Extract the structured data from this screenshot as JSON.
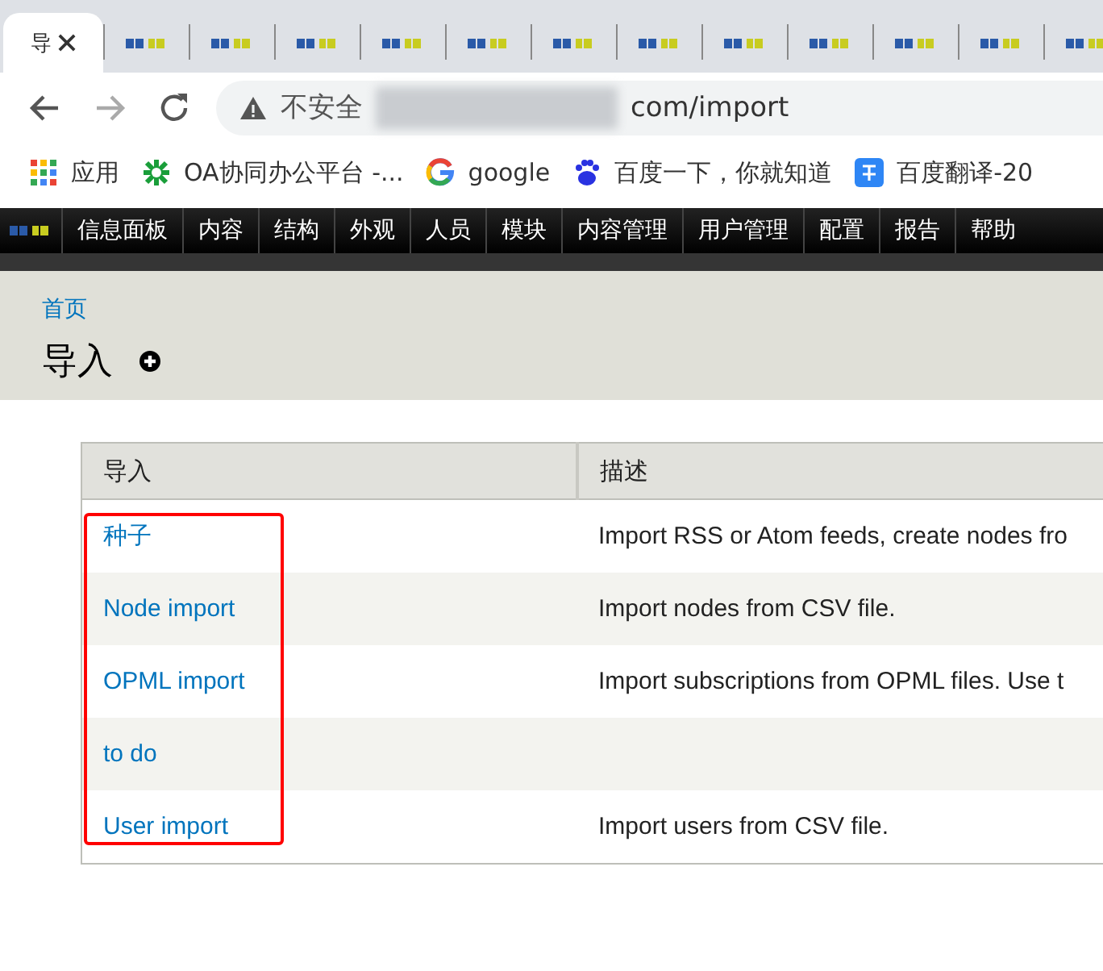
{
  "browser": {
    "tabs": [
      {
        "title": "导",
        "selected": true,
        "closable": true
      },
      {
        "selected": false
      },
      {
        "selected": false
      },
      {
        "selected": false
      },
      {
        "selected": false
      },
      {
        "selected": false
      },
      {
        "selected": false
      },
      {
        "selected": false
      },
      {
        "selected": false
      },
      {
        "selected": false
      },
      {
        "selected": false
      },
      {
        "selected": false
      },
      {
        "selected": false
      }
    ],
    "address_bar": {
      "security_label": "不安全",
      "url": "com/import",
      "redacted": true
    },
    "bookmarks": [
      {
        "kind": "apps",
        "label": "应用"
      },
      {
        "kind": "oa",
        "label": "OA协同办公平台 -..."
      },
      {
        "kind": "google",
        "label": "google"
      },
      {
        "kind": "baidu",
        "label": "百度一下，你就知道"
      },
      {
        "kind": "translate",
        "label": "百度翻译-20"
      }
    ]
  },
  "admin_menu": {
    "items": [
      "信息面板",
      "内容",
      "结构",
      "外观",
      "人员",
      "模块",
      "内容管理",
      "用户管理",
      "配置",
      "报告",
      "帮助"
    ]
  },
  "header": {
    "breadcrumb": "首页",
    "title": "导入"
  },
  "table": {
    "columns": [
      "导入",
      "描述"
    ],
    "highlight_first_column": true,
    "rows": [
      {
        "name": "种子",
        "description": "Import RSS or Atom feeds, create nodes fro"
      },
      {
        "name": "Node import",
        "description": "Import nodes from CSV file."
      },
      {
        "name": "OPML import",
        "description": "Import subscriptions from OPML files. Use t"
      },
      {
        "name": "to do",
        "description": ""
      },
      {
        "name": "User import",
        "description": "Import users from CSV file."
      }
    ]
  }
}
